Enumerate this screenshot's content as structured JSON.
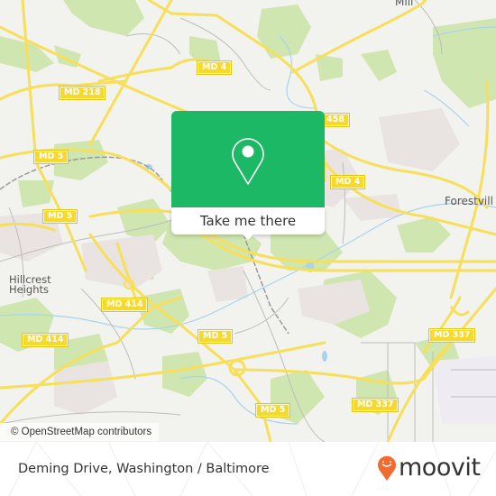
{
  "map": {
    "colors": {
      "land": "#f2f2ef",
      "park": "#c9e3a8",
      "residential": "#e8e2df",
      "road_major": "#f7df5a",
      "road_minor": "#bdbdbd",
      "water": "#a8d4ee",
      "railway": "#9a9a9a"
    },
    "road_shields": [
      {
        "id": "md4-north",
        "label": "MD 4"
      },
      {
        "id": "md218",
        "label": "MD 218"
      },
      {
        "id": "md458",
        "label": "458"
      },
      {
        "id": "md5-west",
        "label": "MD 5"
      },
      {
        "id": "md4-east",
        "label": "MD 4"
      },
      {
        "id": "md5-center-west",
        "label": "MD 5"
      },
      {
        "id": "md414-north",
        "label": "MD 414"
      },
      {
        "id": "md414-south",
        "label": "MD 414"
      },
      {
        "id": "md5-south",
        "label": "MD 5"
      },
      {
        "id": "md337-east",
        "label": "MD 337"
      },
      {
        "id": "md5-bottom",
        "label": "MD 5"
      },
      {
        "id": "md337-south",
        "label": "MD 337"
      }
    ],
    "place_labels": [
      {
        "id": "hillcrest",
        "lines": [
          "Hillcrest",
          "Heights"
        ]
      },
      {
        "id": "forestville",
        "lines": [
          "Forestvill"
        ]
      },
      {
        "id": "mill",
        "lines": [
          "Mill"
        ]
      }
    ],
    "attribution": "© OpenStreetMap contributors"
  },
  "popup": {
    "icon": "map-pin-icon",
    "button_label": "Take me there",
    "accent_color": "#1db866"
  },
  "footer": {
    "location_title": "Deming Drive, Washington / Baltimore",
    "brand": {
      "name": "moovit",
      "icon": "moovit-pin-smile-icon",
      "color": "#f26a2e"
    }
  }
}
